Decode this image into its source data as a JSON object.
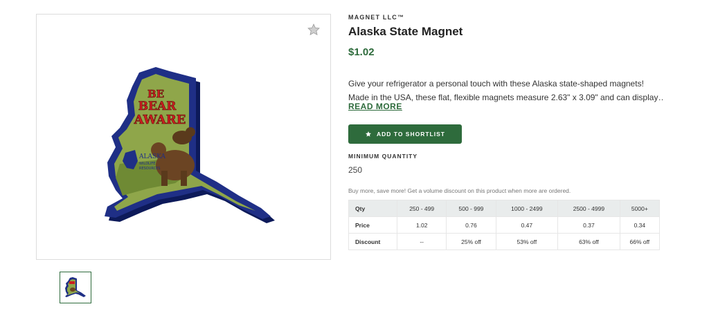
{
  "brand": "MAGNET LLC™",
  "product": {
    "title": "Alaska State Magnet",
    "price": "$1.02",
    "description_line1": "Give your refrigerator a personal touch with these Alaska state-shaped magnets!",
    "description_line2": "Made in the USA, these flat, flexible magnets measure 2.63\" x 3.09\" and can display…",
    "read_more": "READ MORE"
  },
  "image": {
    "text_line1": "BE",
    "text_line2": "BEAR",
    "text_line3": "AWARE",
    "logo_word": "ALASKA",
    "logo_sub1": "WILDLIFE",
    "logo_sub2": "RESOURCES"
  },
  "icons": {
    "favorite": "star-icon",
    "shortlist": "star-icon"
  },
  "actions": {
    "shortlist_label": "ADD TO SHORTLIST"
  },
  "minimum_quantity": {
    "label": "MINIMUM QUANTITY",
    "value": "250"
  },
  "volume_note": "Buy more, save more! Get a volume discount on this product when more are ordered.",
  "price_table": {
    "headers": [
      "Qty",
      "250 - 499",
      "500 - 999",
      "1000 - 2499",
      "2500 - 4999",
      "5000+"
    ],
    "rows": [
      [
        "Price",
        "1.02",
        "0.76",
        "0.47",
        "0.37",
        "0.34"
      ],
      [
        "Discount",
        "--",
        "25% off",
        "53% off",
        "63% off",
        "66% off"
      ]
    ]
  },
  "colors": {
    "accent": "#2e6b3c",
    "table_header_bg": "#e9ecec",
    "magnet_border": "#1f2f86",
    "magnet_fill": "#8fa64a",
    "bear_text": "#cc1f1f"
  }
}
